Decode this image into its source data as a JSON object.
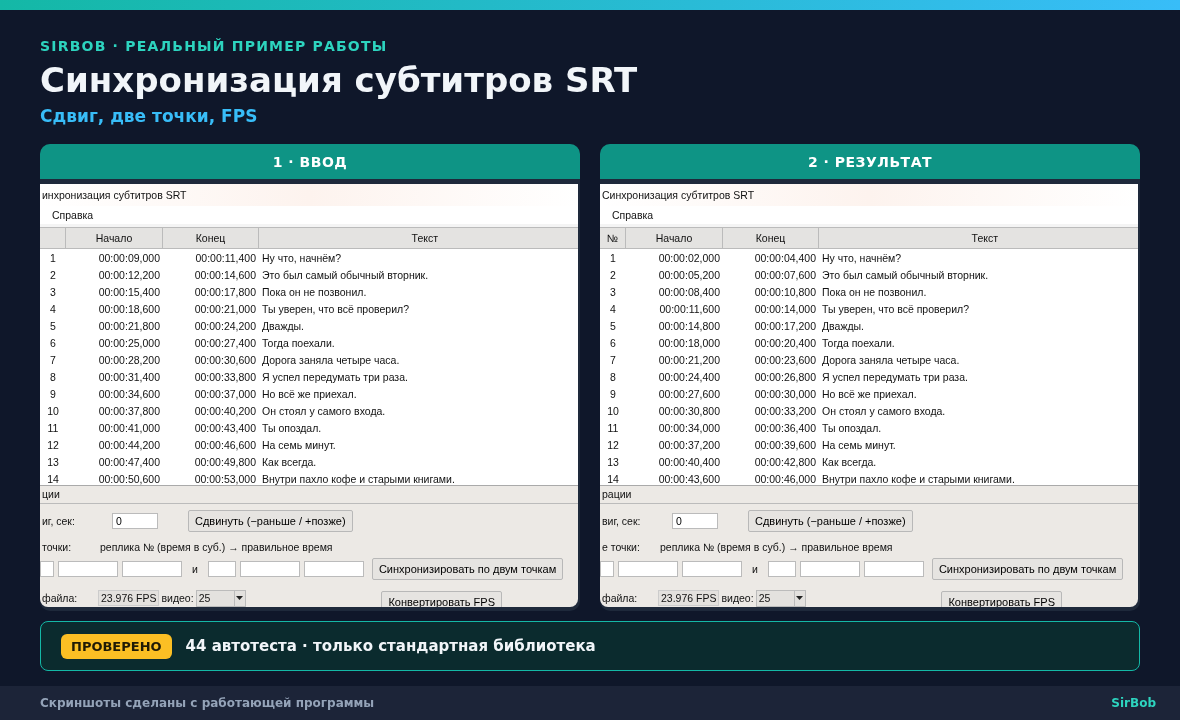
{
  "brand_line": "SIRBOB · РЕАЛЬНЫЙ ПРИМЕР РАБОТЫ",
  "title": "Синхронизация субтитров SRT",
  "subtitle": "Сдвиг, две точки, FPS",
  "panels": [
    {
      "header": "1 · ВВОД",
      "window": {
        "title": "инхронизация субтитров SRT",
        "menu": [
          "Справка"
        ],
        "columns": [
          "",
          "Начало",
          "Конец",
          "Текст"
        ],
        "rows": [
          {
            "n": "1",
            "start": "00:00:09,000",
            "end": "00:00:11,400",
            "text": "Ну что, начнём?"
          },
          {
            "n": "2",
            "start": "00:00:12,200",
            "end": "00:00:14,600",
            "text": "Это был самый обычный вторник."
          },
          {
            "n": "3",
            "start": "00:00:15,400",
            "end": "00:00:17,800",
            "text": "Пока он не позвонил."
          },
          {
            "n": "4",
            "start": "00:00:18,600",
            "end": "00:00:21,000",
            "text": "Ты уверен, что всё проверил?"
          },
          {
            "n": "5",
            "start": "00:00:21,800",
            "end": "00:00:24,200",
            "text": "Дважды."
          },
          {
            "n": "6",
            "start": "00:00:25,000",
            "end": "00:00:27,400",
            "text": "Тогда поехали."
          },
          {
            "n": "7",
            "start": "00:00:28,200",
            "end": "00:00:30,600",
            "text": "Дорога заняла четыре часа."
          },
          {
            "n": "8",
            "start": "00:00:31,400",
            "end": "00:00:33,800",
            "text": "Я успел передумать три раза."
          },
          {
            "n": "9",
            "start": "00:00:34,600",
            "end": "00:00:37,000",
            "text": "Но всё же приехал."
          },
          {
            "n": "10",
            "start": "00:00:37,800",
            "end": "00:00:40,200",
            "text": "Он стоял у самого входа."
          },
          {
            "n": "11",
            "start": "00:00:41,000",
            "end": "00:00:43,400",
            "text": "Ты опоздал."
          },
          {
            "n": "12",
            "start": "00:00:44,200",
            "end": "00:00:46,600",
            "text": "На семь минут."
          },
          {
            "n": "13",
            "start": "00:00:47,400",
            "end": "00:00:49,800",
            "text": "Как всегда."
          },
          {
            "n": "14",
            "start": "00:00:50,600",
            "end": "00:00:53,000",
            "text": "Внутри пахло кофе и старыми книгами."
          }
        ],
        "group_label": "ции",
        "shift_label": "иг, сек:",
        "shift_value": "0",
        "shift_button": "Сдвинуть (−раньше / +позже)",
        "points_label": "точки:",
        "points_hint": "реплика № (время в суб.) → правильное время",
        "and_label": "и",
        "sync_button": "Синхронизировать по двум точкам",
        "fps_label": "файла:",
        "fps_file": "23.976 FPS",
        "video_label": "видео:",
        "video_value": "25",
        "convert_button": "Конвертировать FPS"
      }
    },
    {
      "header": "2 · РЕЗУЛЬТАТ",
      "window": {
        "title": "Синхронизация субтитров SRT",
        "menu": [
          "Справка"
        ],
        "columns": [
          "№",
          "Начало",
          "Конец",
          "Текст"
        ],
        "rows": [
          {
            "n": "1",
            "start": "00:00:02,000",
            "end": "00:00:04,400",
            "text": "Ну что, начнём?"
          },
          {
            "n": "2",
            "start": "00:00:05,200",
            "end": "00:00:07,600",
            "text": "Это был самый обычный вторник."
          },
          {
            "n": "3",
            "start": "00:00:08,400",
            "end": "00:00:10,800",
            "text": "Пока он не позвонил."
          },
          {
            "n": "4",
            "start": "00:00:11,600",
            "end": "00:00:14,000",
            "text": "Ты уверен, что всё проверил?"
          },
          {
            "n": "5",
            "start": "00:00:14,800",
            "end": "00:00:17,200",
            "text": "Дважды."
          },
          {
            "n": "6",
            "start": "00:00:18,000",
            "end": "00:00:20,400",
            "text": "Тогда поехали."
          },
          {
            "n": "7",
            "start": "00:00:21,200",
            "end": "00:00:23,600",
            "text": "Дорога заняла четыре часа."
          },
          {
            "n": "8",
            "start": "00:00:24,400",
            "end": "00:00:26,800",
            "text": "Я успел передумать три раза."
          },
          {
            "n": "9",
            "start": "00:00:27,600",
            "end": "00:00:30,000",
            "text": "Но всё же приехал."
          },
          {
            "n": "10",
            "start": "00:00:30,800",
            "end": "00:00:33,200",
            "text": "Он стоял у самого входа."
          },
          {
            "n": "11",
            "start": "00:00:34,000",
            "end": "00:00:36,400",
            "text": "Ты опоздал."
          },
          {
            "n": "12",
            "start": "00:00:37,200",
            "end": "00:00:39,600",
            "text": "На семь минут."
          },
          {
            "n": "13",
            "start": "00:00:40,400",
            "end": "00:00:42,800",
            "text": "Как всегда."
          },
          {
            "n": "14",
            "start": "00:00:43,600",
            "end": "00:00:46,000",
            "text": "Внутри пахло кофе и старыми книгами."
          }
        ],
        "group_label": "рации",
        "shift_label": "виг, сек:",
        "shift_value": "0",
        "shift_button": "Сдвинуть (−раньше / +позже)",
        "points_label": "е точки:",
        "points_hint": "реплика № (время в суб.) → правильное время",
        "and_label": "и",
        "sync_button": "Синхронизировать по двум точкам",
        "fps_label": "файла:",
        "fps_file": "23.976 FPS",
        "video_label": "видео:",
        "video_value": "25",
        "convert_button": "Конвертировать FPS"
      }
    }
  ],
  "badge": "ПРОВЕРЕНО",
  "badge_text": "44 автотеста · только стандартная библиотека",
  "footer_note": "Скриншоты сделаны с работающей программы",
  "footer_brand": "SirBob"
}
